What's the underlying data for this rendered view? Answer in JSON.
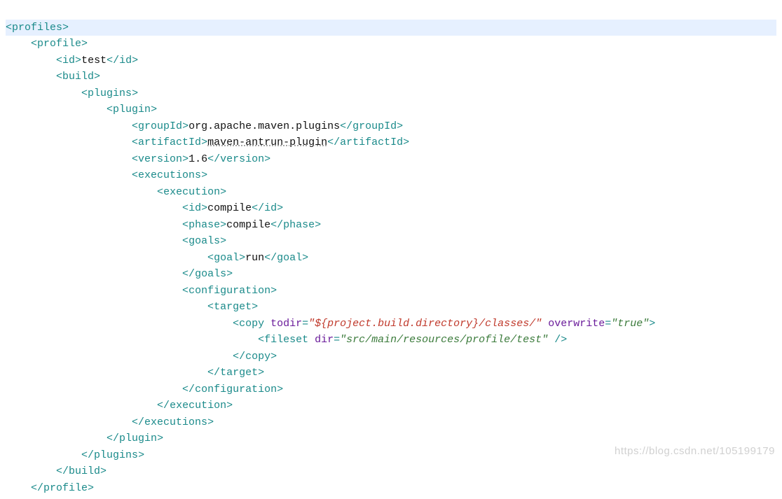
{
  "code": {
    "profiles_open": "profiles",
    "profile_open": "profile",
    "id_open": "id",
    "id_text": "test",
    "id_close": "id",
    "build_open": "build",
    "plugins_open": "plugins",
    "plugin_open": "plugin",
    "groupId_open": "groupId",
    "groupId_text": "org.apache.maven.plugins",
    "groupId_close": "groupId",
    "artifactId_open": "artifactId",
    "artifactId_text": "maven-antrun-plugin",
    "artifactId_close": "artifactId",
    "version_open": "version",
    "version_text": "1.6",
    "version_close": "version",
    "executions_open": "executions",
    "execution_open": "execution",
    "exec_id_open": "id",
    "exec_id_text": "compile",
    "exec_id_close": "id",
    "phase_open": "phase",
    "phase_text": "compile",
    "phase_close": "phase",
    "goals_open": "goals",
    "goal_open": "goal",
    "goal_text": "run",
    "goal_close": "goal",
    "goals_close": "goals",
    "configuration_open": "configuration",
    "target_open": "target",
    "copy_tag": "copy",
    "todir_attr": "todir",
    "todir_val": "\"${project.build.directory}/classes/\"",
    "overwrite_attr": "overwrite",
    "overwrite_val": "\"true\"",
    "fileset_tag": "fileset",
    "dir_attr": "dir",
    "dir_val": "\"src/main/resources/profile/test\"",
    "copy_close": "copy",
    "target_close": "target",
    "configuration_close": "configuration",
    "execution_close": "execution",
    "executions_close": "executions",
    "plugin_close": "plugin",
    "plugins_close": "plugins",
    "build_close": "build",
    "profile_close": "profile"
  },
  "watermark": "https://blog.csdn.net/105199179"
}
